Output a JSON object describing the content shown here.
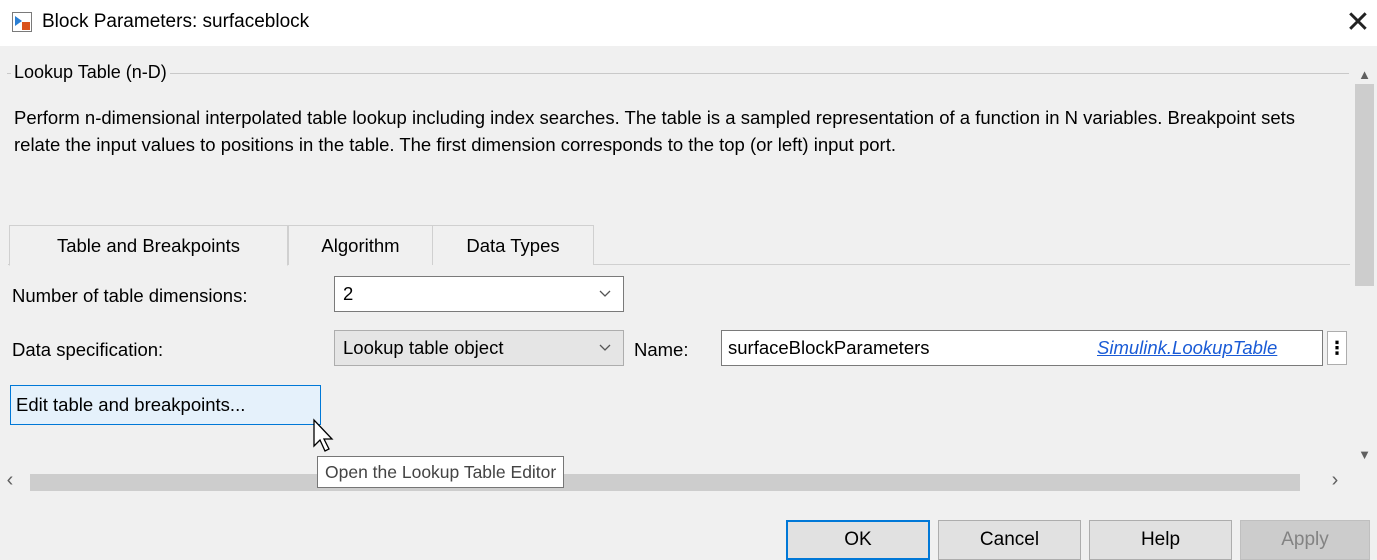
{
  "window": {
    "title": "Block Parameters: surfaceblock",
    "icon": "simulink-block-icon",
    "close_icon": "close-icon"
  },
  "group": {
    "legend": "Lookup Table (n-D)",
    "description": "Perform n-dimensional interpolated table lookup including index searches. The table is a sampled representation of a function in N variables. Breakpoint sets relate the input values to positions in the table. The first dimension corresponds to the top (or left) input port."
  },
  "tabs": [
    {
      "label": "Table and Breakpoints",
      "active": true
    },
    {
      "label": "Algorithm",
      "active": false
    },
    {
      "label": "Data Types",
      "active": false
    }
  ],
  "form": {
    "dimensions_label": "Number of table dimensions:",
    "dimensions_value": "2",
    "data_spec_label": "Data specification:",
    "data_spec_value": "Lookup table object",
    "name_label": "Name:",
    "name_value": "surfaceBlockParameters",
    "name_type_link": "Simulink.LookupTable",
    "more_button_icon": "vertical-ellipsis-icon"
  },
  "edit_button_label": "Edit table and breakpoints...",
  "tooltip": "Open the Lookup Table Editor",
  "buttons": {
    "ok": "OK",
    "cancel": "Cancel",
    "help": "Help",
    "apply": "Apply"
  },
  "colors": {
    "accent": "#0078d7",
    "link": "#1a5bd6",
    "background": "#f0f0f0"
  }
}
